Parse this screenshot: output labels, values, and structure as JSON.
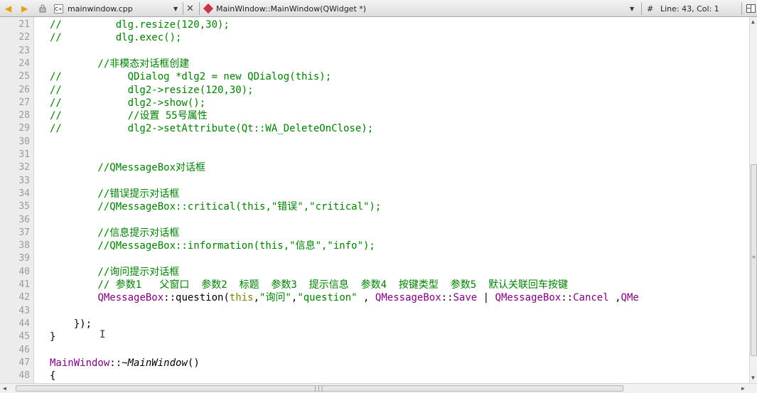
{
  "toolbar": {
    "file_name": "mainwindow.cpp",
    "symbol": "MainWindow::MainWindow(QWidget *)",
    "hash": "#",
    "position": "Line: 43, Col: 1"
  },
  "code_lines": [
    {
      "n": "21",
      "parts": [
        {
          "c": "c",
          "t": "//         dlg.resize(120,30);"
        }
      ]
    },
    {
      "n": "22",
      "parts": [
        {
          "c": "c",
          "t": "//         dlg.exec();"
        }
      ]
    },
    {
      "n": "23",
      "parts": []
    },
    {
      "n": "24",
      "parts": [
        {
          "c": "c",
          "t": "        //非模态对话框创建"
        }
      ]
    },
    {
      "n": "25",
      "parts": [
        {
          "c": "c",
          "t": "//           QDialog *dlg2 = new QDialog(this);"
        }
      ]
    },
    {
      "n": "26",
      "parts": [
        {
          "c": "c",
          "t": "//           dlg2->resize(120,30);"
        }
      ]
    },
    {
      "n": "27",
      "parts": [
        {
          "c": "c",
          "t": "//           dlg2->show();"
        }
      ]
    },
    {
      "n": "28",
      "parts": [
        {
          "c": "c",
          "t": "//           //设置 55号属性"
        }
      ]
    },
    {
      "n": "29",
      "parts": [
        {
          "c": "c",
          "t": "//           dlg2->setAttribute(Qt::WA_DeleteOnClose);"
        }
      ]
    },
    {
      "n": "30",
      "parts": []
    },
    {
      "n": "31",
      "parts": []
    },
    {
      "n": "32",
      "parts": [
        {
          "c": "c",
          "t": "        //QMessageBox对话框"
        }
      ]
    },
    {
      "n": "33",
      "parts": []
    },
    {
      "n": "34",
      "parts": [
        {
          "c": "c",
          "t": "        //错误提示对话框"
        }
      ]
    },
    {
      "n": "35",
      "parts": [
        {
          "c": "c",
          "t": "        //QMessageBox::critical(this,\"错误\",\"critical\");"
        }
      ]
    },
    {
      "n": "36",
      "parts": []
    },
    {
      "n": "37",
      "parts": [
        {
          "c": "c",
          "t": "        //信息提示对话框"
        }
      ]
    },
    {
      "n": "38",
      "parts": [
        {
          "c": "c",
          "t": "        //QMessageBox::information(this,\"信息\",\"info\");"
        }
      ]
    },
    {
      "n": "39",
      "parts": []
    },
    {
      "n": "40",
      "parts": [
        {
          "c": "c",
          "t": "        //询问提示对话框"
        }
      ]
    },
    {
      "n": "41",
      "parts": [
        {
          "c": "c",
          "t": "        // 参数1   父窗口  参数2  标题  参数3  提示信息  参数4  按键类型  参数5  默认关联回车按键"
        }
      ]
    },
    {
      "n": "42",
      "parts": [
        {
          "c": "p",
          "t": "        "
        },
        {
          "c": "t",
          "t": "QMessageBox"
        },
        {
          "c": "p",
          "t": "::question("
        },
        {
          "c": "k",
          "t": "this"
        },
        {
          "c": "p",
          "t": ","
        },
        {
          "c": "s",
          "t": "\"询问\""
        },
        {
          "c": "p",
          "t": ","
        },
        {
          "c": "s",
          "t": "\"question\""
        },
        {
          "c": "p",
          "t": " , "
        },
        {
          "c": "t",
          "t": "QMessageBox"
        },
        {
          "c": "p",
          "t": "::"
        },
        {
          "c": "t",
          "t": "Save"
        },
        {
          "c": "p",
          "t": " | "
        },
        {
          "c": "t",
          "t": "QMessageBox"
        },
        {
          "c": "p",
          "t": "::"
        },
        {
          "c": "t",
          "t": "Cancel"
        },
        {
          "c": "p",
          "t": " ,"
        },
        {
          "c": "t",
          "t": "QMe"
        }
      ]
    },
    {
      "n": "43",
      "parts": []
    },
    {
      "n": "44",
      "parts": [
        {
          "c": "p",
          "t": "    });"
        }
      ]
    },
    {
      "n": "45",
      "parts": [
        {
          "c": "p",
          "t": "}"
        }
      ]
    },
    {
      "n": "46",
      "parts": []
    },
    {
      "n": "47",
      "parts": [
        {
          "c": "t",
          "t": "MainWindow"
        },
        {
          "c": "p",
          "t": "::~"
        },
        {
          "c": "i",
          "t": "MainWindow"
        },
        {
          "c": "p",
          "t": "()"
        }
      ]
    },
    {
      "n": "48",
      "parts": [
        {
          "c": "p",
          "t": "{"
        }
      ]
    }
  ]
}
